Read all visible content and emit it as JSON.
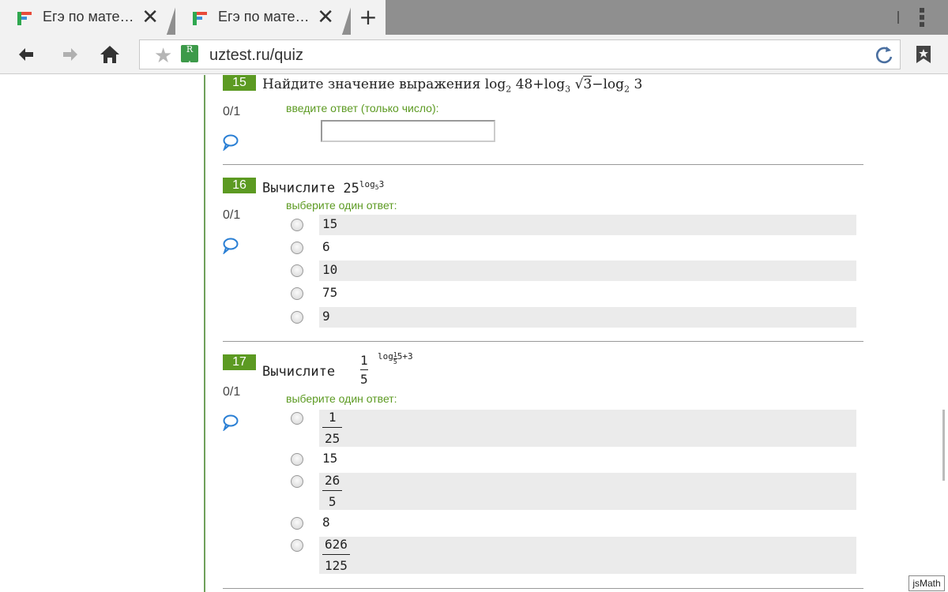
{
  "browser": {
    "tabs": [
      {
        "title": "Егэ по мате…",
        "close": "✕"
      },
      {
        "title": "Егэ по мате…",
        "close": "✕"
      }
    ],
    "new_tab": "+",
    "url": "uztest.ru/quiz",
    "site_badge": "R"
  },
  "page": {
    "jsmath_label": "jsMath",
    "questions": [
      {
        "number": "15",
        "score": "0/1",
        "prompt_text": "Найдите значение выражения",
        "expression": {
          "t1": "log",
          "b1": "2",
          "a1": "48",
          "plus": "+",
          "t2": "log",
          "b2": "3",
          "rad": "3",
          "minus": "−",
          "t3": "log",
          "b3": "2",
          "a3": "3"
        },
        "hint": "введите ответ (только число):",
        "input_value": ""
      },
      {
        "number": "16",
        "score": "0/1",
        "prompt_text": "Вычислите",
        "expression": {
          "base": "25",
          "exp_log": "log",
          "exp_sub": "5",
          "exp_arg": "3"
        },
        "hint": "выберите один ответ:",
        "options": [
          "15",
          "6",
          "10",
          "75",
          "9"
        ]
      },
      {
        "number": "17",
        "score": "0/1",
        "prompt_text": "Вычислите",
        "expression": {
          "num": "1",
          "den": "5",
          "exp_log": "log",
          "exp_sub_num": "1",
          "exp_sub_den": "5",
          "exp_rest": "5+3"
        },
        "hint": "выберите один ответ:",
        "options": [
          {
            "num": "1",
            "den": "25"
          },
          {
            "text": "15"
          },
          {
            "num": "26",
            "den": "5"
          },
          {
            "text": "8"
          },
          {
            "num": "626",
            "den": "125"
          }
        ]
      }
    ]
  },
  "colors": {
    "accent_green": "#5c9a22",
    "link_blue": "#2a7fd4"
  }
}
